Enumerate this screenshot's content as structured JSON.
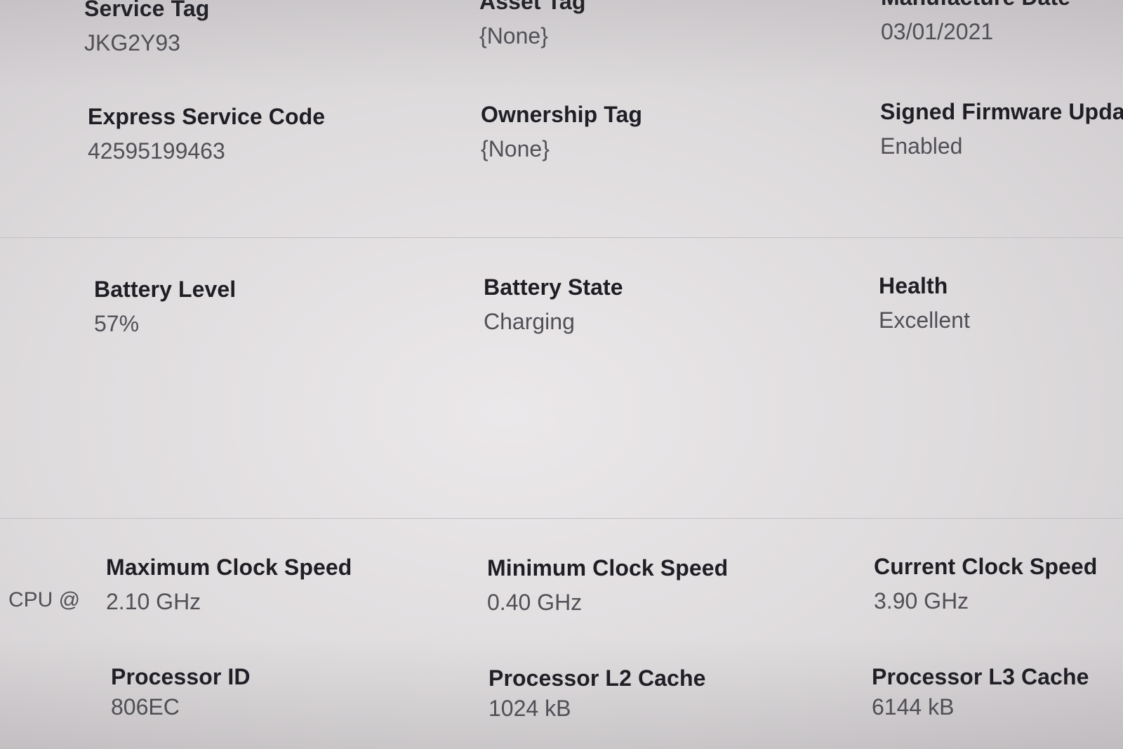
{
  "system_info": {
    "service_tag": {
      "label": "Service Tag",
      "value": "JKG2Y93"
    },
    "asset_tag": {
      "label": "Asset Tag",
      "value": "{None}"
    },
    "manufacture_date": {
      "label": "Manufacture Date",
      "value": "03/01/2021"
    },
    "express_service_code": {
      "label": "Express Service Code",
      "value": "42595199463"
    },
    "ownership_tag": {
      "label": "Ownership Tag",
      "value": "{None}"
    },
    "signed_firmware_update": {
      "label": "Signed Firmware Updat",
      "value": "Enabled"
    }
  },
  "battery": {
    "level": {
      "label": "Battery Level",
      "value": "57%"
    },
    "state": {
      "label": "Battery State",
      "value": "Charging"
    },
    "health": {
      "label": "Health",
      "value": "Excellent"
    }
  },
  "processor": {
    "name_fragment": "CPU @",
    "max_clock": {
      "label": "Maximum Clock Speed",
      "value": "2.10 GHz"
    },
    "min_clock": {
      "label": "Minimum Clock Speed",
      "value": "0.40 GHz"
    },
    "current_clock": {
      "label": "Current Clock Speed",
      "value": "3.90 GHz"
    },
    "processor_id": {
      "label": "Processor ID",
      "value": "806EC"
    },
    "l2_cache": {
      "label": "Processor L2 Cache",
      "value": "1024 kB"
    },
    "l3_cache": {
      "label": "Processor L3 Cache",
      "value": "6144 kB"
    }
  }
}
